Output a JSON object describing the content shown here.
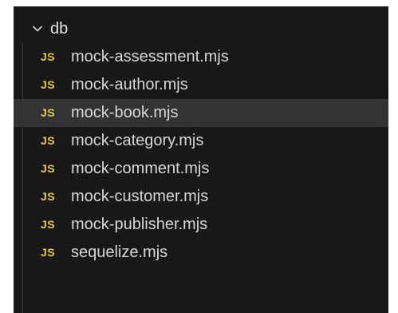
{
  "explorer": {
    "folder": {
      "name": "db",
      "expanded": true
    },
    "files": [
      {
        "icon": "JS",
        "name": "mock-assessment.mjs",
        "selected": false
      },
      {
        "icon": "JS",
        "name": "mock-author.mjs",
        "selected": false
      },
      {
        "icon": "JS",
        "name": "mock-book.mjs",
        "selected": true
      },
      {
        "icon": "JS",
        "name": "mock-category.mjs",
        "selected": false
      },
      {
        "icon": "JS",
        "name": "mock-comment.mjs",
        "selected": false
      },
      {
        "icon": "JS",
        "name": "mock-customer.mjs",
        "selected": false
      },
      {
        "icon": "JS",
        "name": "mock-publisher.mjs",
        "selected": false
      },
      {
        "icon": "JS",
        "name": "sequelize.mjs",
        "selected": false
      }
    ]
  },
  "colors": {
    "background": "#181818",
    "selected_row": "#333336",
    "js_icon": "#e8c84b",
    "text": "#d7d7d7"
  }
}
